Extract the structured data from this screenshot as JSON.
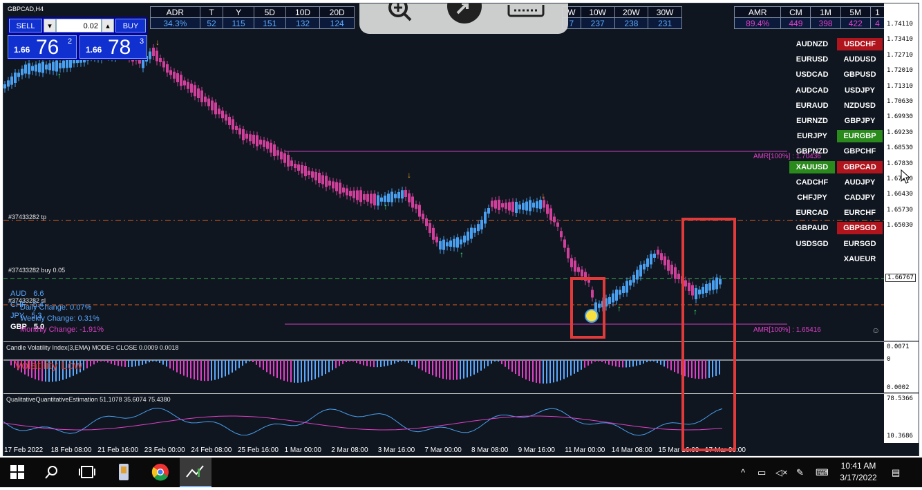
{
  "window": {
    "symbol": "GBPCAD,H4"
  },
  "trade_panel": {
    "sell_label": "SELL",
    "buy_label": "BUY",
    "lot_value": "0.02",
    "sell_prefix": "1.66",
    "sell_big": "76",
    "sell_sup": "2",
    "buy_prefix": "1.66",
    "buy_big": "78",
    "buy_sup": "3"
  },
  "range_table": {
    "headers": [
      "ADR",
      "T",
      "Y",
      "5D",
      "10D",
      "20D"
    ],
    "values": [
      "34.3%",
      "52",
      "115",
      "151",
      "132",
      "124"
    ]
  },
  "range_table2": {
    "headers": [
      "W",
      "10W",
      "20W",
      "30W"
    ],
    "values": [
      "7",
      "237",
      "238",
      "231"
    ]
  },
  "range_table3": {
    "headers": [
      "AMR",
      "CM",
      "1M",
      "5M",
      "1"
    ],
    "values": [
      "89.4%",
      "449",
      "398",
      "422",
      "4"
    ]
  },
  "pairs": [
    {
      "left": "AUDNZD",
      "right": "USDCHF",
      "right_color": "#b0141c"
    },
    {
      "left": "EURUSD",
      "right": "AUDUSD"
    },
    {
      "left": "USDCAD",
      "right": "GBPUSD"
    },
    {
      "left": "AUDCAD",
      "right": "USDJPY"
    },
    {
      "left": "EURAUD",
      "right": "NZDUSD"
    },
    {
      "left": "EURNZD",
      "right": "GBPJPY"
    },
    {
      "left": "EURJPY",
      "right": "EURGBP",
      "right_color": "#2a8a1c"
    },
    {
      "left": "GBPNZD",
      "right": "GBPCHF"
    },
    {
      "left": "XAUUSD",
      "right": "GBPCAD",
      "left_color": "#2a8a1c",
      "right_color": "#b0141c"
    },
    {
      "left": "CADCHF",
      "right": "AUDJPY"
    },
    {
      "left": "CHFJPY",
      "right": "CADJPY"
    },
    {
      "left": "EURCAD",
      "right": "EURCHF"
    },
    {
      "left": "GBPAUD",
      "right": "GBPSGD",
      "right_color": "#b0141c"
    },
    {
      "left": "USDSGD",
      "right": "EURSGD"
    },
    {
      "left": "",
      "right": "XAUEUR"
    }
  ],
  "price_axis": [
    "1.74110",
    "1.73410",
    "1.72710",
    "1.72010",
    "1.71310",
    "1.70630",
    "1.69930",
    "1.69230",
    "1.68530",
    "1.67830",
    "1.67130",
    "1.66430",
    "1.65730",
    "1.65030"
  ],
  "current_price": "1.66767",
  "labels": {
    "tp": "#37433282 tp",
    "buy": "#37433282 buy 0.05",
    "sl": "#37433282 sl",
    "amr_top": "AMR[100%] : 1.70436",
    "amr_bottom": "AMR[100%] : 1.65416"
  },
  "strength": [
    {
      "cur": "AUD",
      "val": "6.6"
    },
    {
      "cur": "CHF",
      "val": "5.4"
    },
    {
      "cur": "JPY",
      "val": "5.3"
    },
    {
      "cur": "GBP",
      "val": "5.0"
    }
  ],
  "changes": {
    "daily": "Daily Change: 0.07%",
    "weekly": "Weekly Change: 0.31%",
    "monthly": "Monthly Change: -1.91%"
  },
  "indicator1": {
    "title": "Candle Volatility Index(3,EMA) MODE= CLOSE 0.0009 0.0018",
    "status": "Volatility Low",
    "axis_top": "0.0071",
    "axis_bottom": "0.0002"
  },
  "indicator2": {
    "title": "QualitativeQuantitativeEstimation 51.1078 35.6074 75.4380",
    "axis_top": "78.5366",
    "axis_bottom": "10.3686"
  },
  "dates": [
    "17 Feb 2022",
    "18 Feb 08:00",
    "21 Feb 16:00",
    "23 Feb 00:00",
    "24 Feb 08:00",
    "25 Feb 16:00",
    "1 Mar 00:00",
    "2 Mar 08:00",
    "3 Mar 16:00",
    "7 Mar 00:00",
    "8 Mar 08:00",
    "9 Mar 16:00",
    "11 Mar 00:00",
    "14 Mar 08:00",
    "15 Mar 16:00",
    "17 Mar 00:00"
  ],
  "taskbar": {
    "time": "10:41 AM",
    "date": "3/17/2022"
  }
}
